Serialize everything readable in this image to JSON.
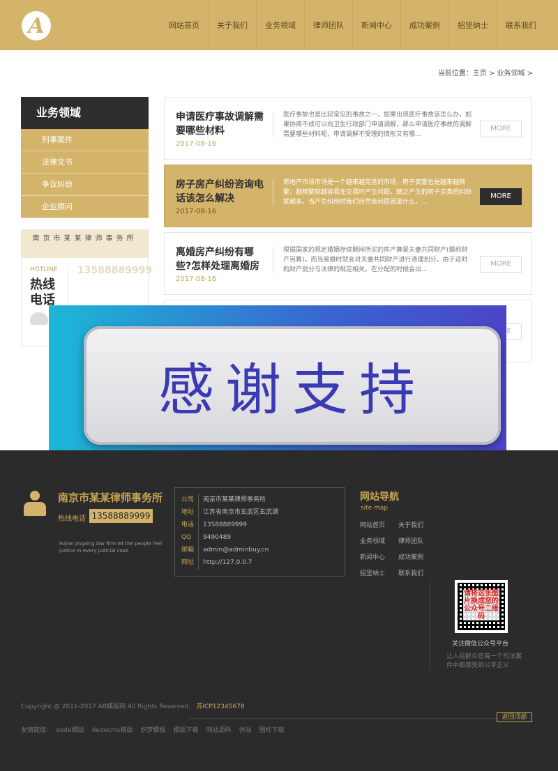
{
  "colors": {
    "gold": "#d4b46a",
    "dark": "#2d2d2d",
    "footer_bg": "#2b2b2b"
  },
  "header": {
    "logo_letter": "A",
    "nav": [
      "网站首页",
      "关于我们",
      "业务领域",
      "律师团队",
      "新闻中心",
      "成功案例",
      "招坚纳士",
      "联系我们"
    ]
  },
  "breadcrumb": "当前位置：主页 > 业务领域 >",
  "sidebar": {
    "title": "业务领域",
    "items": [
      "刑事案件",
      "法律文书",
      "争议纠纷",
      "企业顾问"
    ]
  },
  "contact_box": {
    "title": "南京市某某律师事务所",
    "hotline_en": "HOTLINE",
    "hotline_cn": "热线电话",
    "number": "13588889999"
  },
  "articles": [
    {
      "title": "申请医疗事故调解需要哪些材料",
      "date": "2017-08-16",
      "desc": "医疗事故也是比较常见的事故之一，如果出现医疗事故该怎么办，如果协商不成可以向卫生行政部门申请调解，那么申请医疗事故的调解需要哪些材料呢，申请调解不受理的情形又有哪...",
      "more": "MORE"
    },
    {
      "title": "房子房产纠纷咨询电话该怎么解决",
      "date": "2017-08-16",
      "desc": "房地产市场市场是一个越来越完善的市场，房子卖家也是越来越频繁，越频繁就越容易在交易时产生问题，随之产生的房子买卖的纠纷就越多。当产生纠纷时我们自然会问原因是什么，...",
      "more": "MORE"
    },
    {
      "title": "离婚房产纠纷有哪些?怎样处理离婚房",
      "date": "2017-08-16",
      "desc": "根据国家的规定婚姻存续期间所买的房产算是夫妻共同财产(婚前财产另算)。而当离婚时就会对夫妻共同财产进行清理划分，由于这时的财产划分与法律的规定相关，在分配的时候会出...",
      "more": "MORE"
    },
    {
      "title": "",
      "date": "",
      "desc": "",
      "more": "MORE"
    }
  ],
  "overlay_text": "感谢支持",
  "footer": {
    "firm_name": "南京市某某律师事务所",
    "hotline_label": "热线电话",
    "hotline": "13588889999",
    "slogan": "Fujian jingxing law firm let the people feel justice in every judicial case",
    "info": [
      {
        "k": "公司",
        "v": "南京市某某律师事务所"
      },
      {
        "k": "地址",
        "v": "江苏省南京市玄武区玄武湖"
      },
      {
        "k": "电话",
        "v": "13588889999"
      },
      {
        "k": "QQ",
        "v": "9490489"
      },
      {
        "k": "邮箱",
        "v": "admin@adminbuy.cn"
      },
      {
        "k": "网址",
        "v": "http://127.0.0.7"
      }
    ],
    "sitemap_title": "网站导航",
    "sitemap_en": "site map",
    "sitemap_links": [
      "网站首页",
      "关于我们",
      "业务领域",
      "律师团队",
      "新闻中心",
      "成功案例",
      "招坚纳士",
      "联系我们"
    ],
    "qr_overlay": "请将这张图片换成您的公众号二维码",
    "qr_label": "关注微信公众号平台",
    "qr_desc": "让人民群众在每一个司法案件中都感受到公平正义",
    "copyright": "Copyright @ 2011-2017 AB模版网 All Rights Reserved.",
    "icp": "苏ICP12345678",
    "back_top": "返回顶部",
    "friends_label": "友情链接:",
    "friends": [
      "dede模版",
      "dedecms模版",
      "织梦模板",
      "模版下载",
      "网站源码",
      "仿站",
      "图标下载"
    ]
  }
}
